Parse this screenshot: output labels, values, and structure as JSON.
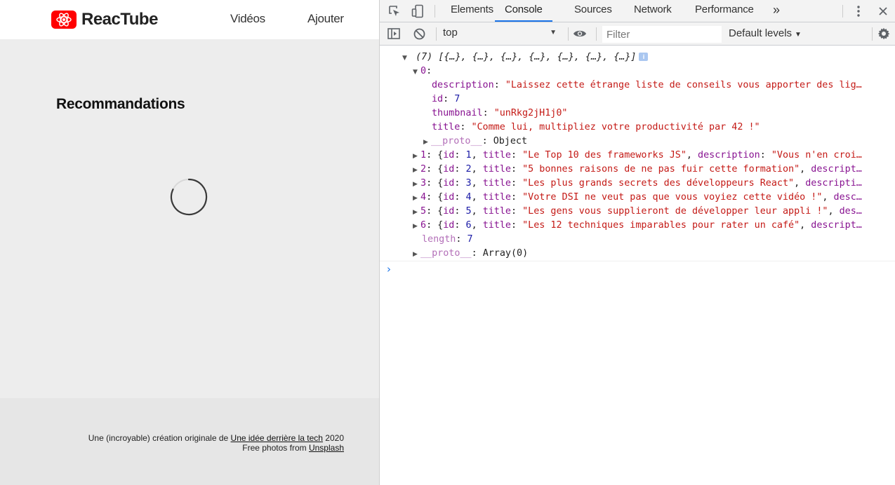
{
  "app": {
    "brand": "ReacTube",
    "nav": {
      "videos": "Vidéos",
      "add": "Ajouter"
    },
    "section_title": "Recommandations",
    "footer": {
      "line1_prefix": "Une (incroyable) création originale de ",
      "line1_link": "Une idée derrière la tech",
      "line1_suffix": " 2020",
      "line2_prefix": "Free photos from ",
      "line2_link": "Unsplash"
    },
    "colors": {
      "brand_red": "#ff0000",
      "page_bg": "#ededed",
      "footer_bg": "#e6e6e6"
    }
  },
  "devtools": {
    "tabs": [
      "Elements",
      "Console",
      "Sources",
      "Network",
      "Performance"
    ],
    "active_tab": "Console",
    "more_tabs": "»",
    "context": "top",
    "filter_placeholder": "Filter",
    "levels": "Default levels",
    "icons": [
      "inspect-icon",
      "device-toggle-icon",
      "kebab-menu-icon",
      "close-icon",
      "sidebar-toggle-icon",
      "clear-console-icon",
      "eye-icon",
      "gear-icon"
    ],
    "console": {
      "summary_count": "(7)",
      "summary_items": "[{…}, {…}, {…}, {…}, {…}, {…}, {…}]",
      "item0_index": "0",
      "item0": {
        "description_key": "description",
        "description_value": "\"Laissez cette étrange liste de conseils vous apporter des lig…",
        "id_key": "id",
        "id_value": "7",
        "thumbnail_key": "thumbnail",
        "thumbnail_value": "\"unRkg2jH1j0\"",
        "title_key": "title",
        "title_value": "\"Comme lui, multipliez votre productivité par 42 !\"",
        "proto_key": "__proto__",
        "proto_value": "Object"
      },
      "rows": [
        {
          "index": "1",
          "id": "1",
          "title": "\"Le Top 10 des frameworks JS\"",
          "tail": "description",
          "tail_value": "\"Vous n'en croi…"
        },
        {
          "index": "2",
          "id": "2",
          "title": "\"5 bonnes raisons de ne pas fuir cette formation\"",
          "tail": "descript…",
          "tail_value": ""
        },
        {
          "index": "3",
          "id": "3",
          "title": "\"Les plus grands secrets des développeurs React\"",
          "tail": "descripti…",
          "tail_value": ""
        },
        {
          "index": "4",
          "id": "4",
          "title": "\"Votre DSI ne veut pas que vous voyiez cette vidéo !\"",
          "tail": "desc…",
          "tail_value": ""
        },
        {
          "index": "5",
          "id": "5",
          "title": "\"Les gens vous supplieront de développer leur appli !\"",
          "tail": "des…",
          "tail_value": ""
        },
        {
          "index": "6",
          "id": "6",
          "title": "\"Les 12 techniques imparables pour rater un café\"",
          "tail": "descript…",
          "tail_value": ""
        }
      ],
      "length_key": "length",
      "length_value": "7",
      "array_proto_key": "__proto__",
      "array_proto_value": "Array(0)",
      "prompt": "›"
    }
  }
}
